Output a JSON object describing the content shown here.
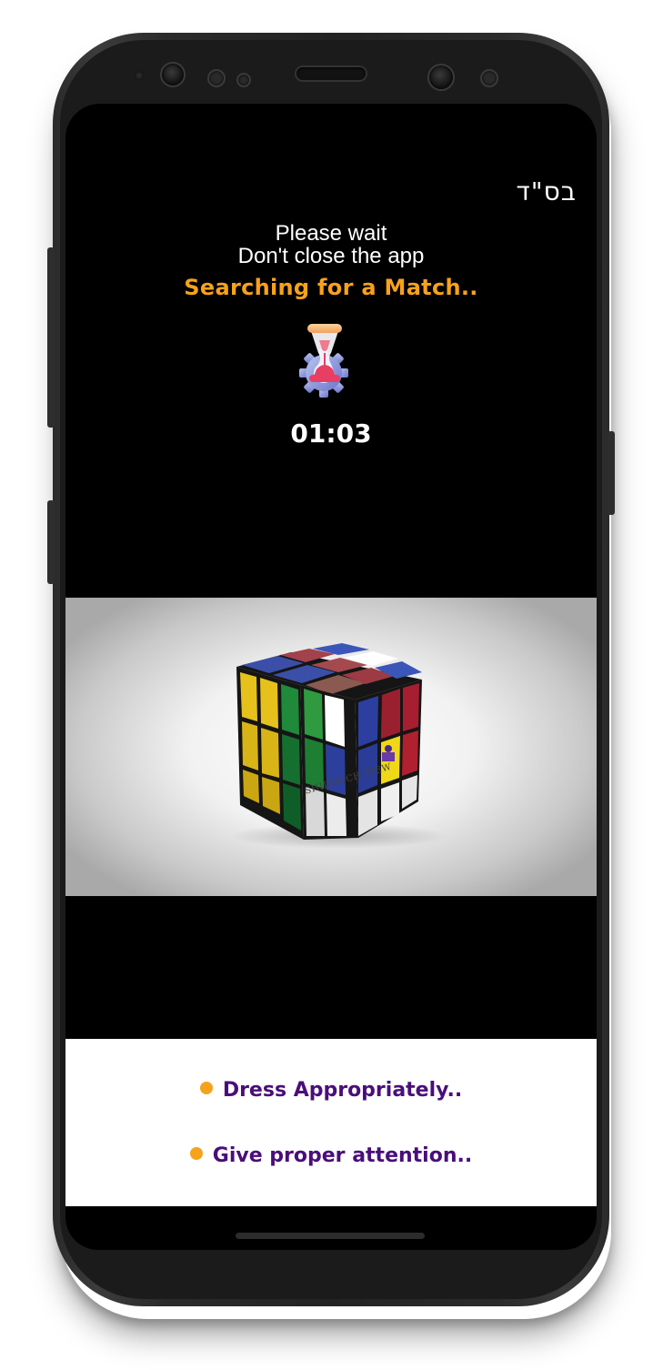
{
  "header": {
    "hebrew_mark": "בס\"ד"
  },
  "status": {
    "line1": "Please wait",
    "line2": "Don't close the app",
    "searching": "Searching for a Match..",
    "timer": "01:03"
  },
  "video": {
    "brand_text": "SHIDDUCH VIEW"
  },
  "tips": [
    {
      "text": "Dress Appropriately.."
    },
    {
      "text": "Give proper attention.."
    }
  ],
  "colors": {
    "accent_orange": "#F7A21B",
    "tip_purple": "#4A0E7A",
    "screen_background": "#000000"
  },
  "icons": {
    "hourglass": "hourglass-gear-icon",
    "bullet": "orange-dot-icon"
  }
}
